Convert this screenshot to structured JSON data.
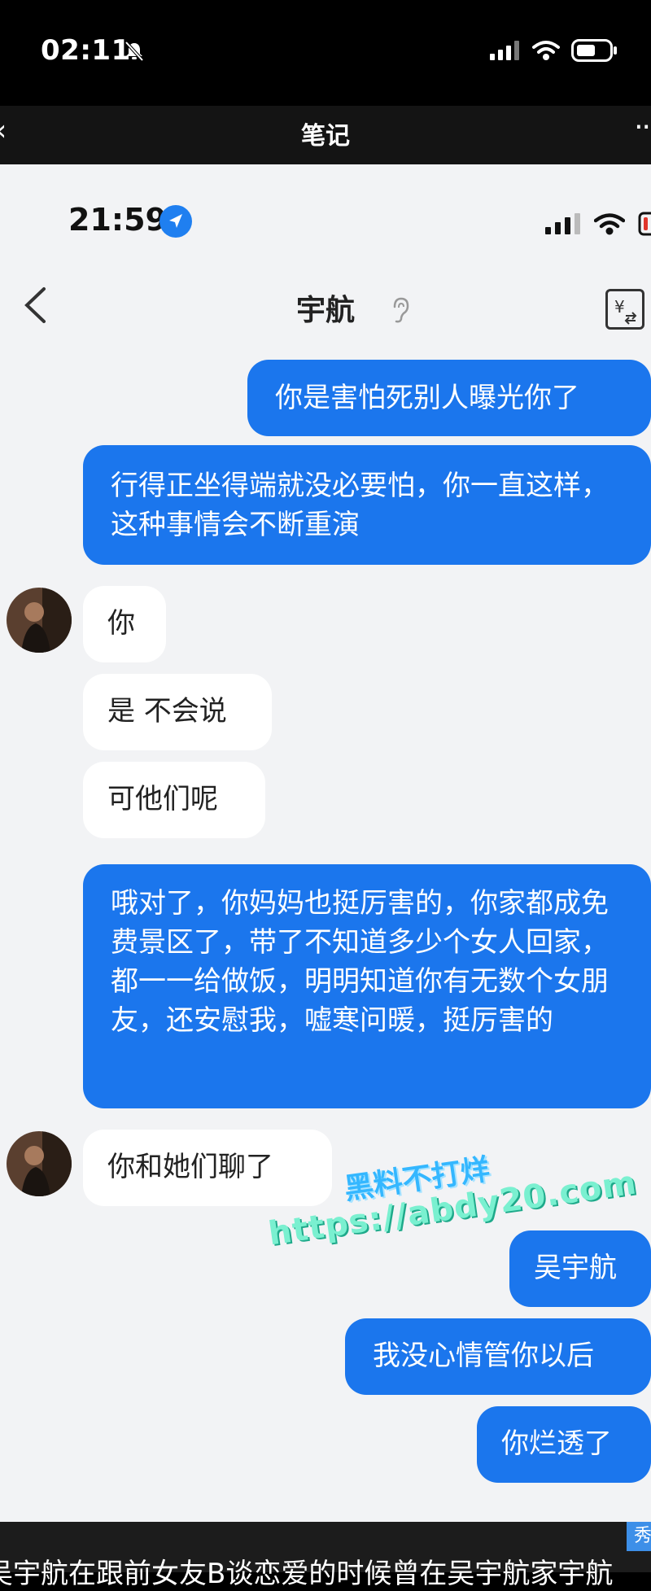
{
  "outer": {
    "time": "02:11",
    "title": "笔记"
  },
  "inner": {
    "time": "21:59",
    "contact": "宇航"
  },
  "messages": [
    {
      "side": "me",
      "text": "你是害怕死别人曝光你了"
    },
    {
      "side": "me",
      "text": "行得正坐得端就没必要怕，你一直这样，这种事情会不断重演"
    },
    {
      "side": "them",
      "text": "你"
    },
    {
      "side": "them",
      "text": "是 不会说"
    },
    {
      "side": "them",
      "text": "可他们呢"
    },
    {
      "side": "me",
      "text": "哦对了，你妈妈也挺厉害的，你家都成免费景区了，带了不知道多少个女人回家，都一一给做饭，明明知道你有无数个女朋友，还安慰我，嘘寒问暖，挺厉害的"
    },
    {
      "side": "them",
      "text": "你和她们聊了"
    },
    {
      "side": "me",
      "text": "吴宇航"
    },
    {
      "side": "me",
      "text": "我没心情管你以后"
    },
    {
      "side": "me",
      "text": "你烂透了"
    }
  ],
  "watermark": {
    "line1": "黑料不打烊",
    "line2": "https://abdy20.com"
  },
  "caption": "吴宇航在跟前女友B谈恋爱的时候曾在吴宇航家宇航",
  "corner_badge": "秀",
  "colors": {
    "me_bubble": "#1b76ed",
    "them_bubble": "#ffffff",
    "background": "#f2f3f5"
  }
}
